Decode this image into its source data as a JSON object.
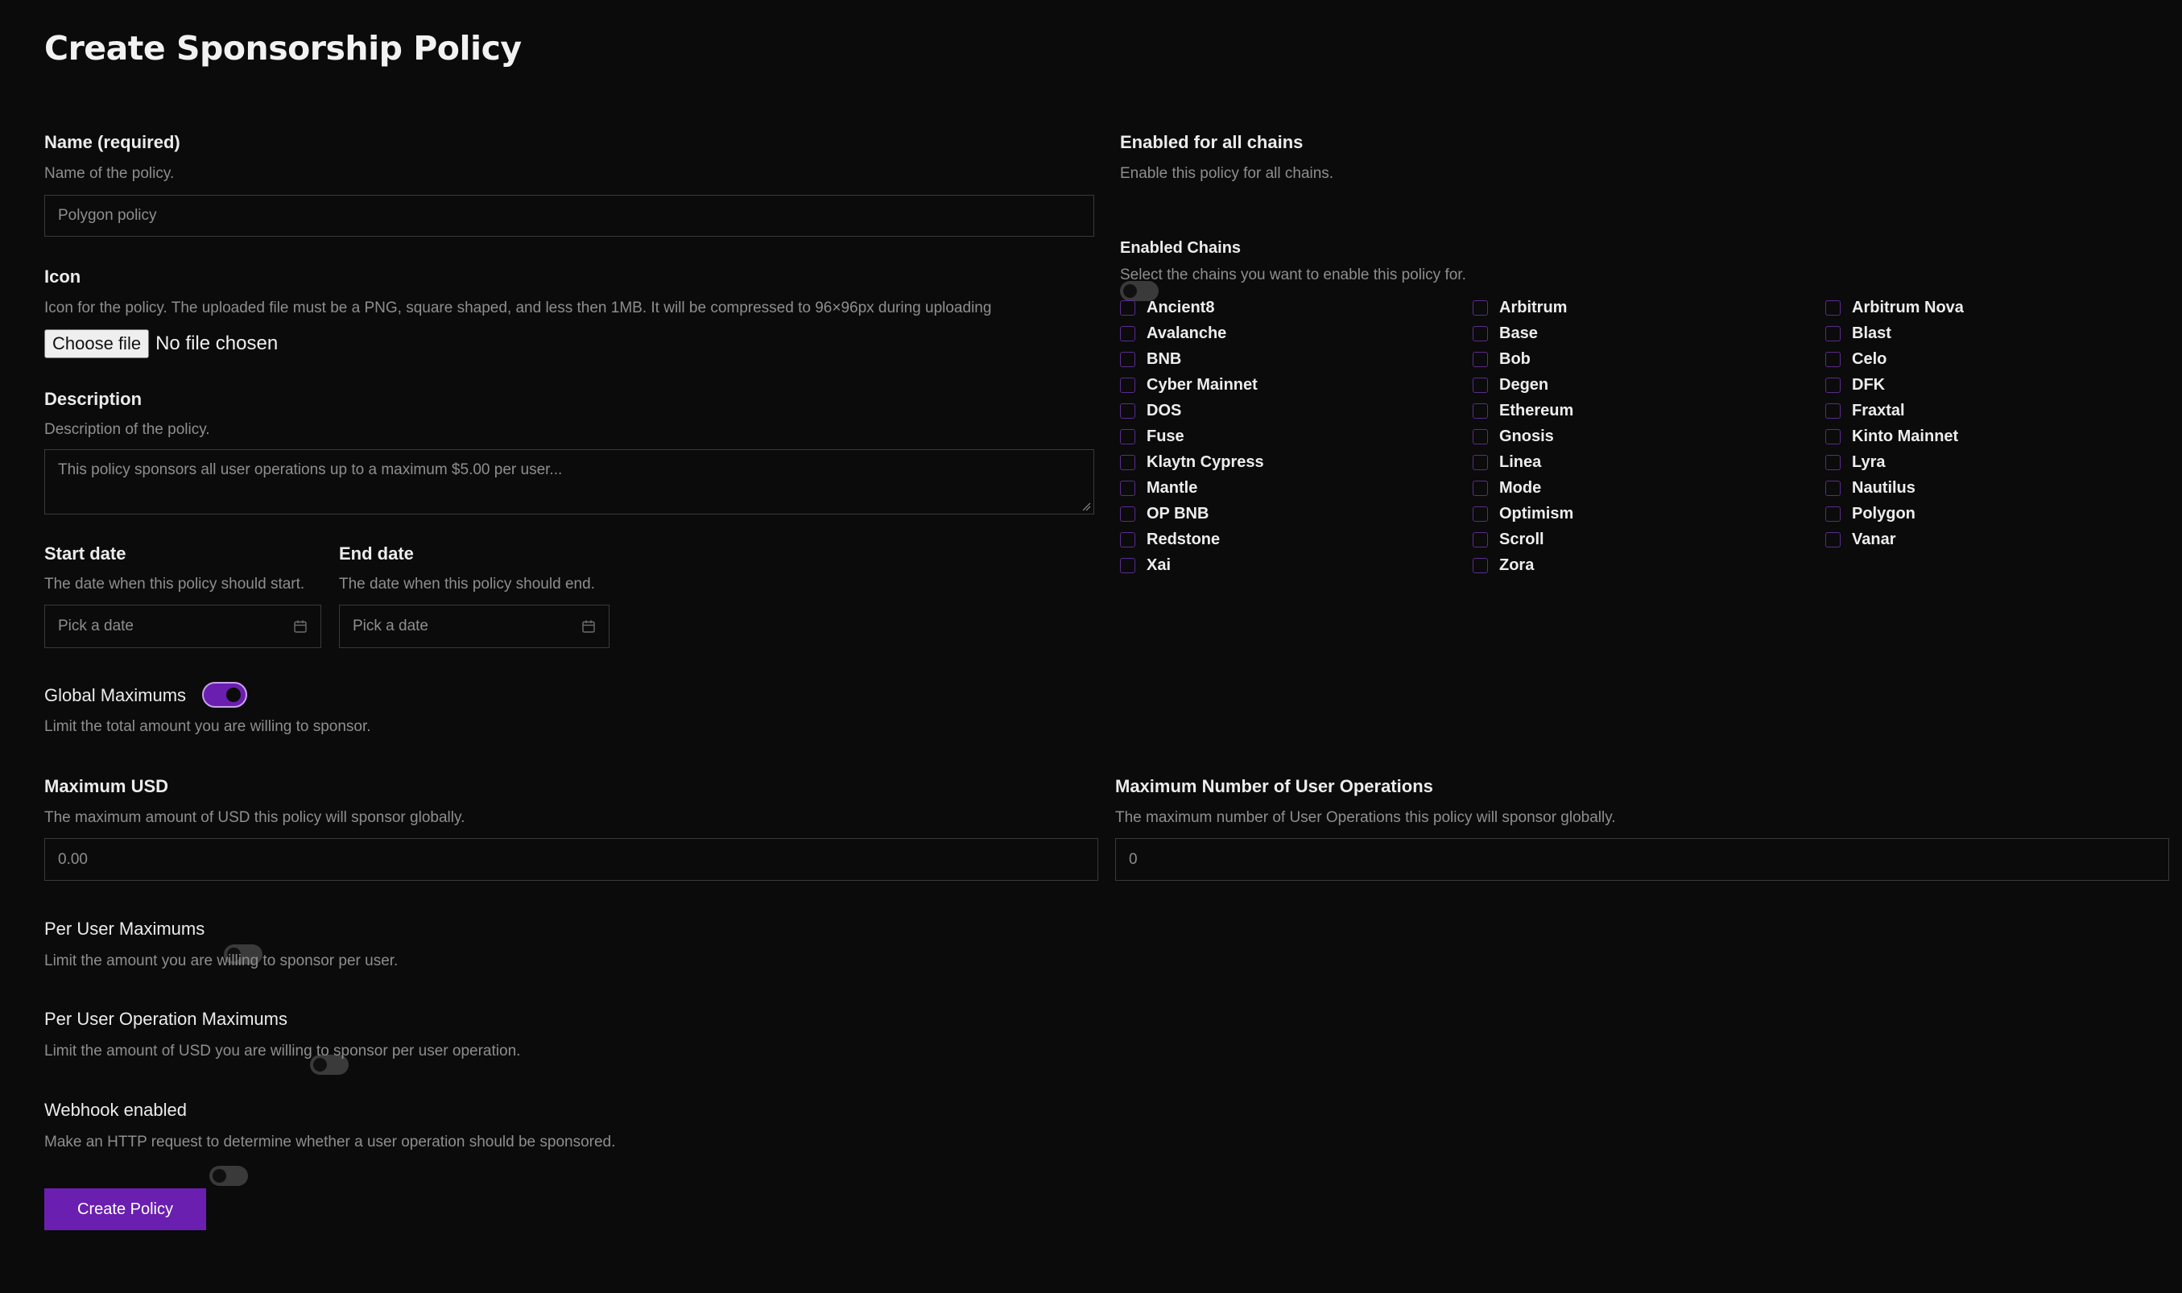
{
  "page": {
    "title": "Create Sponsorship Policy"
  },
  "name": {
    "label": "Name (required)",
    "description": "Name of the policy.",
    "placeholder": "Polygon policy"
  },
  "icon": {
    "label": "Icon",
    "description": "Icon for the policy. The uploaded file must be a PNG, square shaped, and less then 1MB. It will be compressed to 96×96px during uploading",
    "button_label": "Choose file",
    "status": "No file chosen"
  },
  "description": {
    "label": "Description",
    "description": "Description of the policy.",
    "placeholder": "This policy sponsors all user operations up to a maximum $5.00 per user..."
  },
  "start_date": {
    "label": "Start date",
    "description": "The date when this policy should start.",
    "placeholder": "Pick a date"
  },
  "end_date": {
    "label": "End date",
    "description": "The date when this policy should end.",
    "placeholder": "Pick a date"
  },
  "global_maximums": {
    "label": "Global Maximums",
    "description": "Limit the total amount you are willing to sponsor.",
    "enabled": true
  },
  "maximum_usd": {
    "label": "Maximum USD",
    "description": "The maximum amount of USD this policy will sponsor globally.",
    "placeholder": "0.00"
  },
  "maximum_ops": {
    "label": "Maximum Number of User Operations",
    "description": "The maximum number of User Operations this policy will sponsor globally.",
    "placeholder": "0"
  },
  "per_user": {
    "label": "Per User Maximums",
    "description": "Limit the amount you are willing to sponsor per user.",
    "enabled": false
  },
  "per_user_op": {
    "label": "Per User Operation Maximums",
    "description": "Limit the amount of USD you are willing to sponsor per user operation.",
    "enabled": false
  },
  "webhook": {
    "label": "Webhook enabled",
    "description": "Make an HTTP request to determine whether a user operation should be sponsored.",
    "enabled": false
  },
  "all_chains": {
    "label": "Enabled for all chains",
    "description": "Enable this policy for all chains.",
    "enabled": false
  },
  "chains": {
    "label": "Enabled Chains",
    "description": "Select the chains you want to enable this policy for.",
    "items": [
      "Ancient8",
      "Arbitrum",
      "Arbitrum Nova",
      "Avalanche",
      "Base",
      "Blast",
      "BNB",
      "Bob",
      "Celo",
      "Cyber Mainnet",
      "Degen",
      "DFK",
      "DOS",
      "Ethereum",
      "Fraxtal",
      "Fuse",
      "Gnosis",
      "Kinto Mainnet",
      "Klaytn Cypress",
      "Linea",
      "Lyra",
      "Mantle",
      "Mode",
      "Nautilus",
      "OP BNB",
      "Optimism",
      "Polygon",
      "Redstone",
      "Scroll",
      "Vanar",
      "Xai",
      "Zora"
    ]
  },
  "submit": {
    "label": "Create Policy"
  },
  "colors": {
    "background": "#0b0b0b",
    "accent": "#6a1fb0",
    "border": "#3a3a3a",
    "muted_text": "#8e8e8e"
  }
}
